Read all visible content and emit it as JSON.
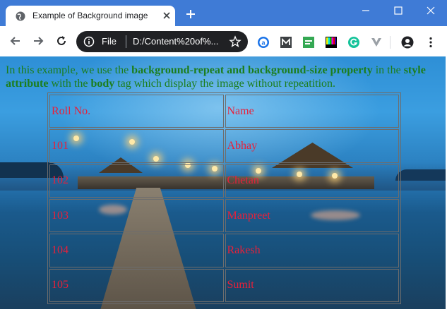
{
  "browser": {
    "tab_title": "Example of Background image",
    "omnibox": {
      "scheme": "File",
      "url": "D:/Content%20of%..."
    },
    "icons": {
      "favicon": "globe-icon",
      "tab_close": "close-icon",
      "new_tab": "plus-icon",
      "minimize": "minimize-icon",
      "maximize": "maximize-icon",
      "close": "close-icon",
      "back": "back-arrow-icon",
      "forward": "forward-arrow-icon",
      "reload": "reload-icon",
      "info": "info-icon",
      "bookmark": "star-icon",
      "profile": "profile-icon",
      "menu": "more-vert-icon"
    },
    "colors": {
      "tabstrip": "#3f7bd6",
      "omnibox": "#202124"
    }
  },
  "page": {
    "intro": {
      "t1": "In this example, we use the ",
      "b1": "background-repeat and background-size property",
      "t2": " in the ",
      "b2": "style attribute",
      "t3": " with the ",
      "b3": "body",
      "t4": " tag which display the image without repeatition."
    },
    "table": {
      "headers": [
        "Roll No.",
        "Name"
      ],
      "rows": [
        [
          "101",
          "Abhay"
        ],
        [
          "102",
          "Chetan"
        ],
        [
          "103",
          "Manpreet"
        ],
        [
          "104",
          "Rakesh"
        ],
        [
          "105",
          "Sumit"
        ]
      ]
    },
    "colors": {
      "intro_text": "#1c7e1c",
      "table_text": "#e8203a"
    }
  }
}
